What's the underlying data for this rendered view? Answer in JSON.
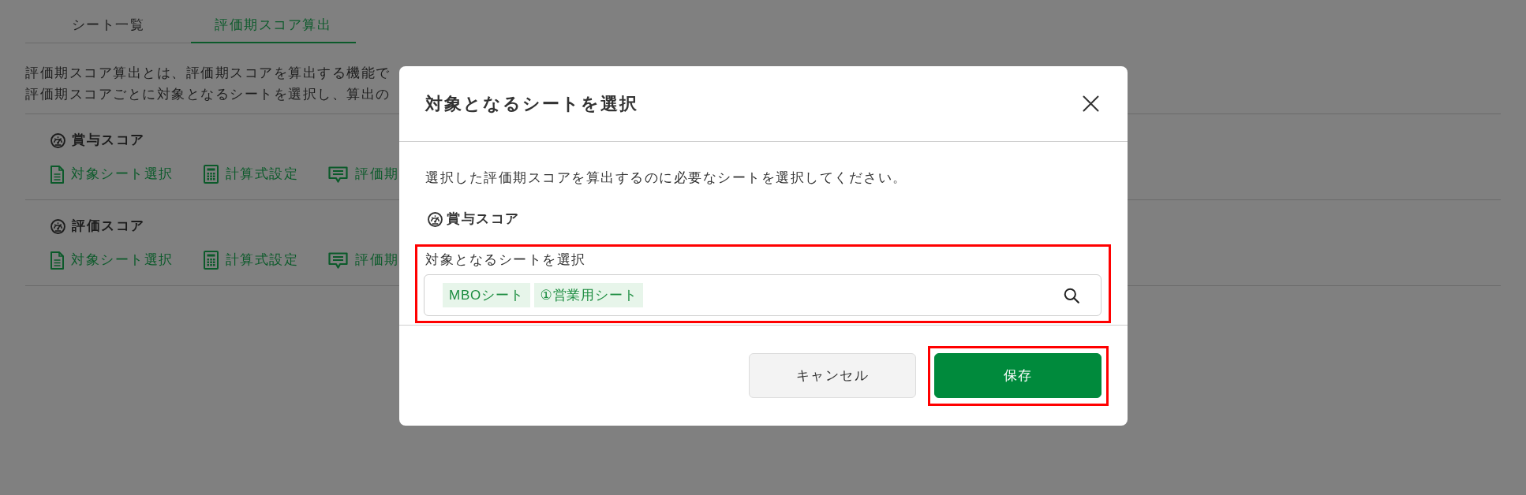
{
  "tabs": [
    {
      "label": "シート一覧",
      "selected": false
    },
    {
      "label": "評価期スコア算出",
      "selected": true
    }
  ],
  "description": [
    "評価期スコア算出とは、評価期スコアを算出する機能で",
    "評価期スコアごとに対象となるシートを選択し、算出の"
  ],
  "score_sections": [
    {
      "title": "賞与スコア",
      "links": [
        {
          "kind": "sheet",
          "label": "対象シート選択"
        },
        {
          "kind": "formula",
          "label": "計算式設定"
        },
        {
          "kind": "comment",
          "label": "評価期"
        }
      ]
    },
    {
      "title": "評価スコア",
      "links": [
        {
          "kind": "sheet",
          "label": "対象シート選択"
        },
        {
          "kind": "formula",
          "label": "計算式設定"
        },
        {
          "kind": "comment",
          "label": "評価期"
        }
      ]
    }
  ],
  "dialog": {
    "title": "対象となるシートを選択",
    "message": "選択した評価期スコアを算出するのに必要なシートを選択してください。",
    "section_title": "賞与スコア",
    "field": {
      "label": "対象となるシートを選択",
      "highlighted": true,
      "chips": [
        "MBOシート",
        "①営業用シート"
      ]
    },
    "buttons": [
      {
        "kind": "secondary",
        "label": "キャンセル",
        "highlighted": false
      },
      {
        "kind": "primary",
        "label": "保存",
        "highlighted": true
      }
    ]
  }
}
